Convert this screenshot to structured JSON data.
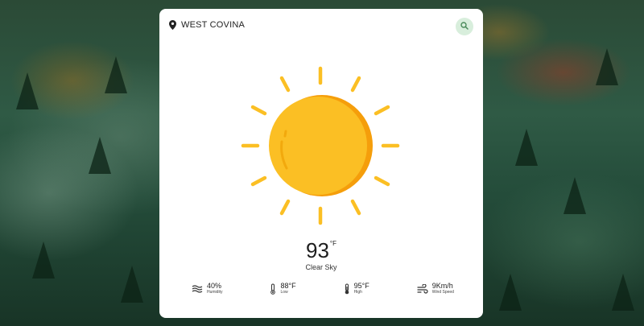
{
  "location": {
    "name": "WEST COVINA"
  },
  "weather": {
    "temperature": "93",
    "unit": "°F",
    "condition": "Clear Sky",
    "icon": "sun-icon"
  },
  "stats": [
    {
      "icon": "humidity-icon",
      "value": "40%",
      "label": "Humidity"
    },
    {
      "icon": "thermometer-low-icon",
      "value": "88°F",
      "label": "Low"
    },
    {
      "icon": "thermometer-high-icon",
      "value": "95°F",
      "label": "High"
    },
    {
      "icon": "wind-icon",
      "value": "9Km/h",
      "label": "Wind Speed"
    }
  ],
  "colors": {
    "sun": "#fbbf24",
    "sun_shade": "#f59e0b",
    "search_bg": "#d8eedc",
    "card": "#ffffff"
  }
}
